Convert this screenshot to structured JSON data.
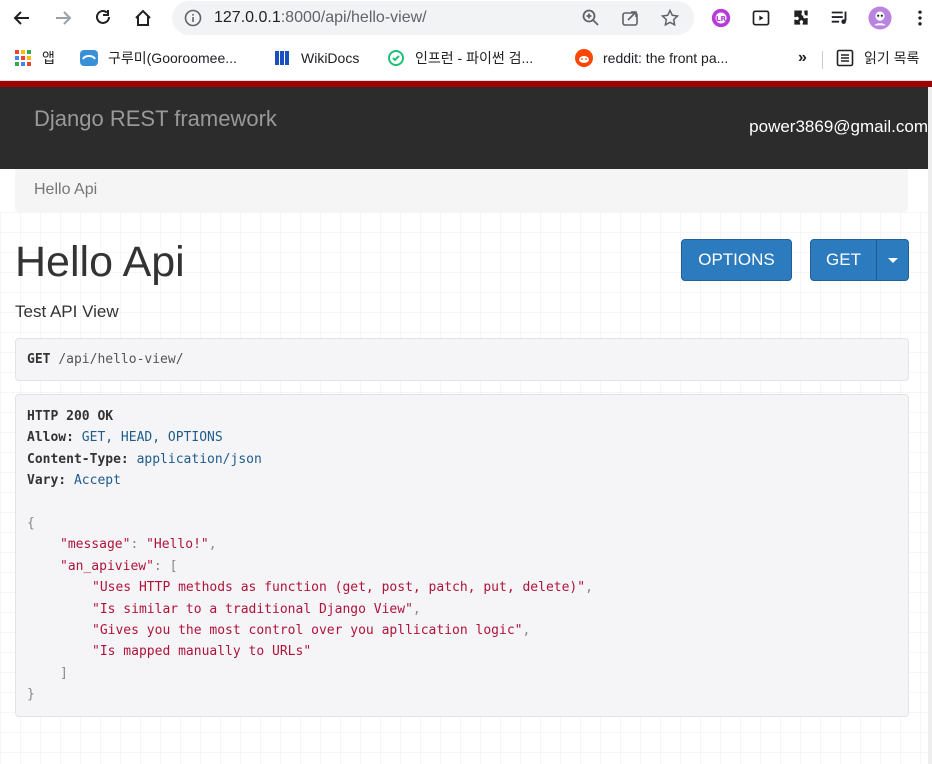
{
  "browser": {
    "url_host": "127.0.0.1",
    "url_rest": ":8000/api/hello-view/",
    "bookmarks": [
      {
        "label": "앱",
        "icon": "apps-grid-icon"
      },
      {
        "label": "구루미(Gooroomee...",
        "icon": "gooroomee-icon"
      },
      {
        "label": "WikiDocs",
        "icon": "wikidocs-icon"
      },
      {
        "label": "인프런 - 파이썬 검...",
        "icon": "inflearn-icon"
      },
      {
        "label": "reddit: the front pa...",
        "icon": "reddit-icon"
      }
    ],
    "overflow_label": "»",
    "reading_list_label": "읽기 목록",
    "colors": {
      "accent": "#2c7bbf",
      "redline": "#a30000"
    }
  },
  "navbar": {
    "brand": "Django REST framework",
    "user": "power3869@gmail.com"
  },
  "breadcrumb": {
    "current": "Hello Api"
  },
  "page": {
    "title": "Hello Api",
    "description": "Test API View",
    "options_label": "OPTIONS",
    "get_label": "GET"
  },
  "request": {
    "method": "GET",
    "path": "/api/hello-view/"
  },
  "response": {
    "status": "HTTP 200 OK",
    "headers": [
      {
        "name": "Allow:",
        "value": "GET, HEAD, OPTIONS"
      },
      {
        "name": "Content-Type:",
        "value": "application/json"
      },
      {
        "name": "Vary:",
        "value": "Accept"
      }
    ],
    "body": {
      "open": "{",
      "message_key": "\"message\"",
      "message_value": "\"Hello!\"",
      "apiview_key": "\"an_apiview\"",
      "items": [
        "\"Uses HTTP methods as function (get, post, patch, put, delete)\"",
        "\"Is similar to a traditional Django View\"",
        "\"Gives you the most control over you apllication logic\"",
        "\"Is mapped manually to URLs\""
      ],
      "close_list": "]",
      "close": "}"
    }
  }
}
